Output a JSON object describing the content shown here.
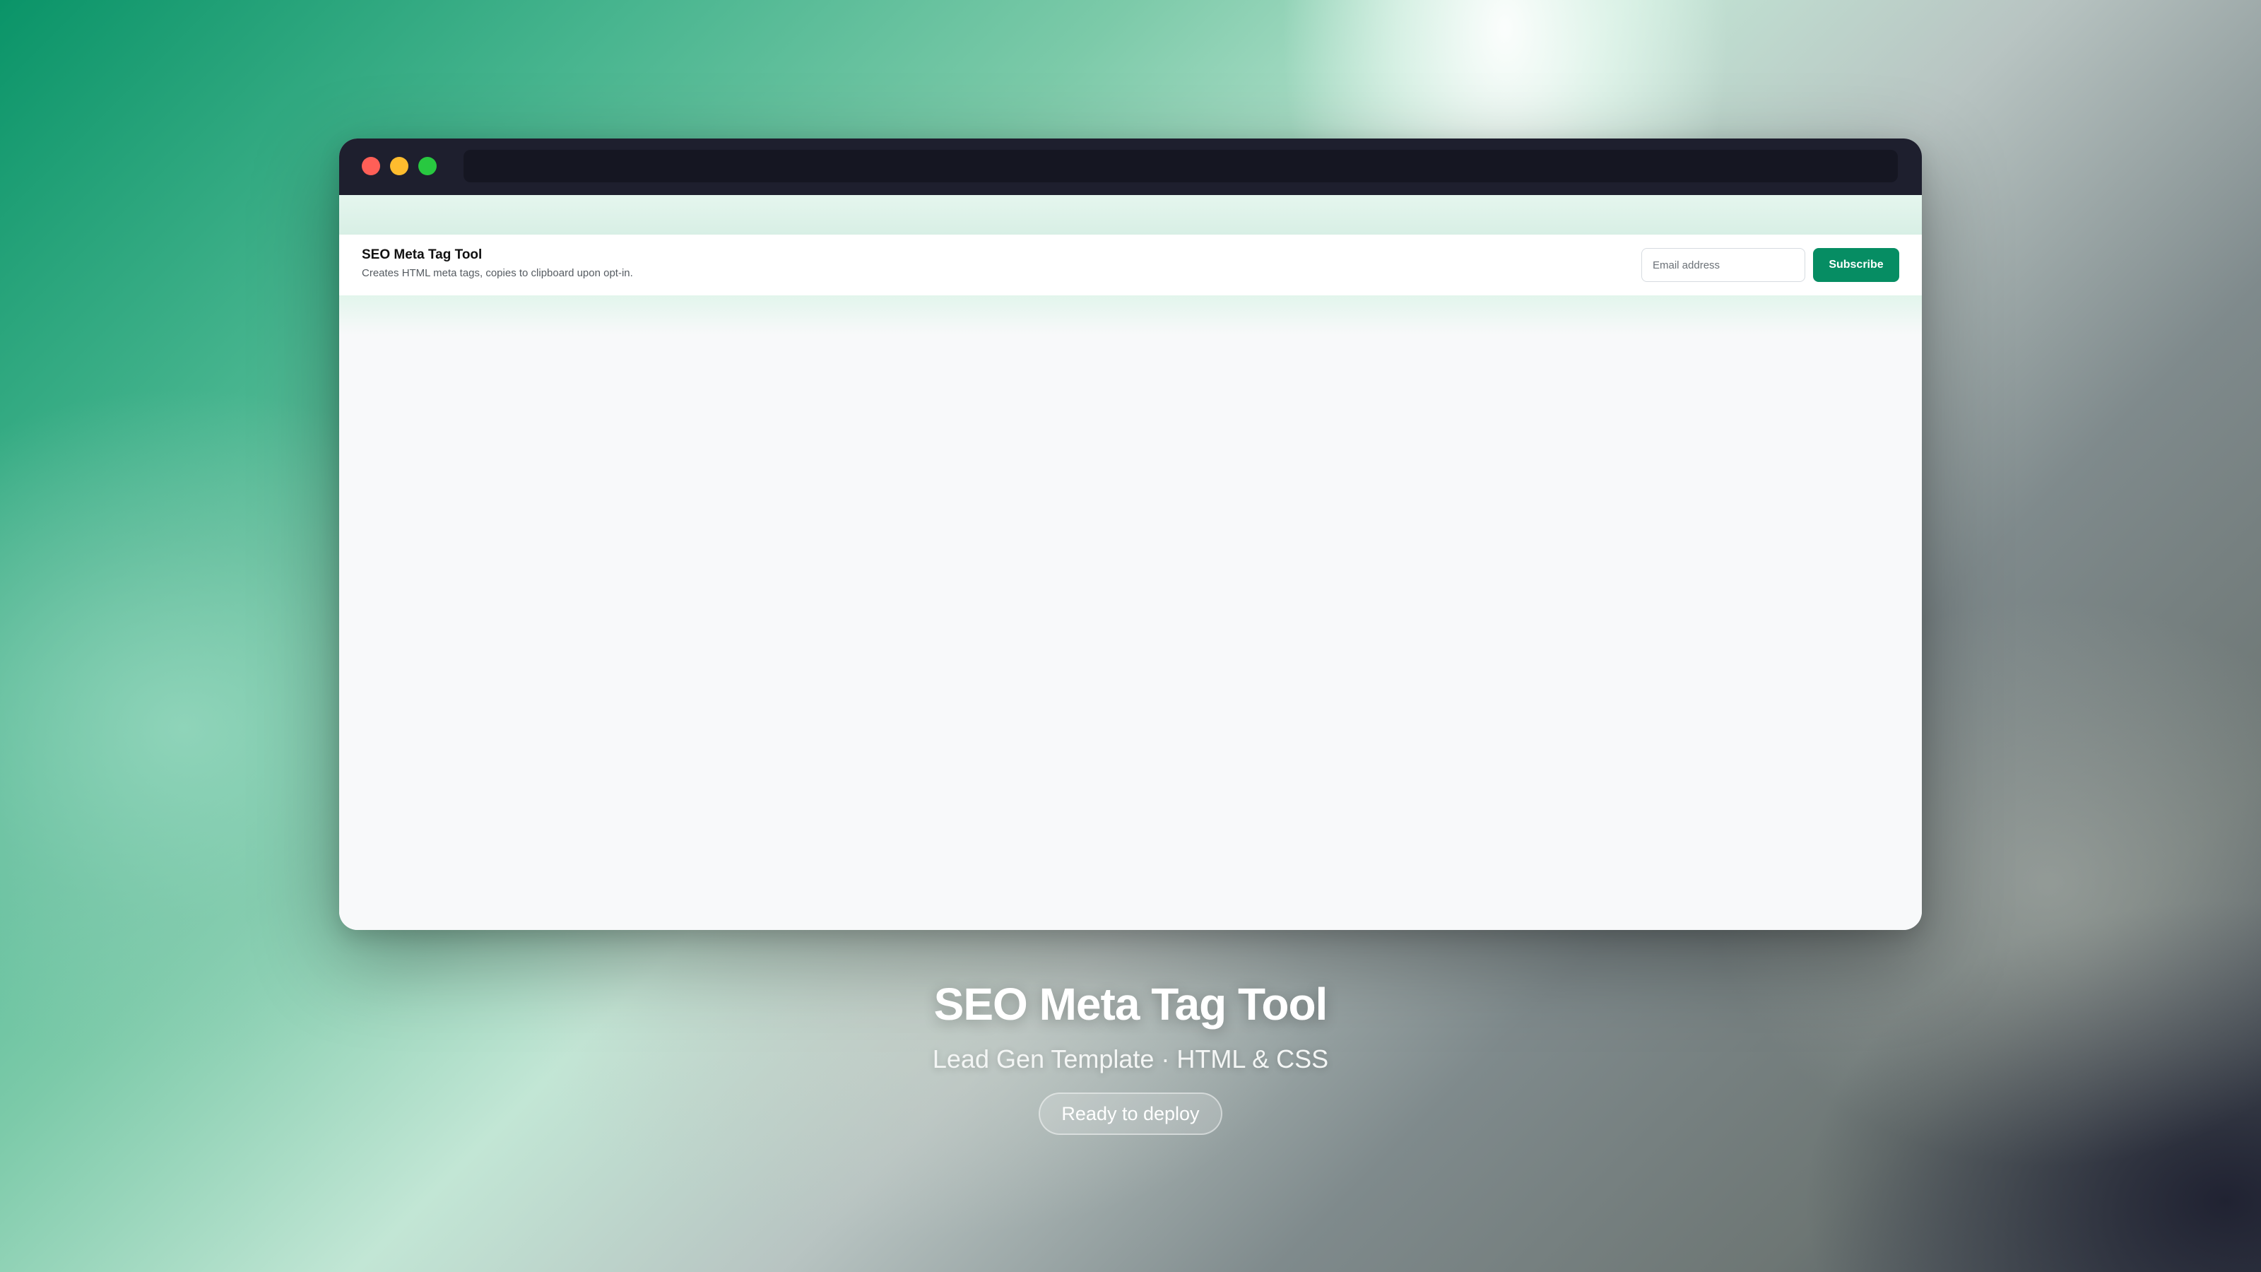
{
  "lead_bar": {
    "title": "SEO Meta Tag Tool",
    "description": "Creates HTML meta tags, copies to clipboard upon opt-in.",
    "email_placeholder": "Email address",
    "subscribe_label": "Subscribe"
  },
  "caption": {
    "title": "SEO Meta Tag Tool",
    "subtitle": "Lead Gen Template · HTML & CSS",
    "badge": "Ready to deploy"
  },
  "colors": {
    "accent": "#068d63",
    "titlebar": "#1e1f2e",
    "close_dot": "#ff5f57",
    "minimize_dot": "#febc2e",
    "maximize_dot": "#28c840"
  }
}
